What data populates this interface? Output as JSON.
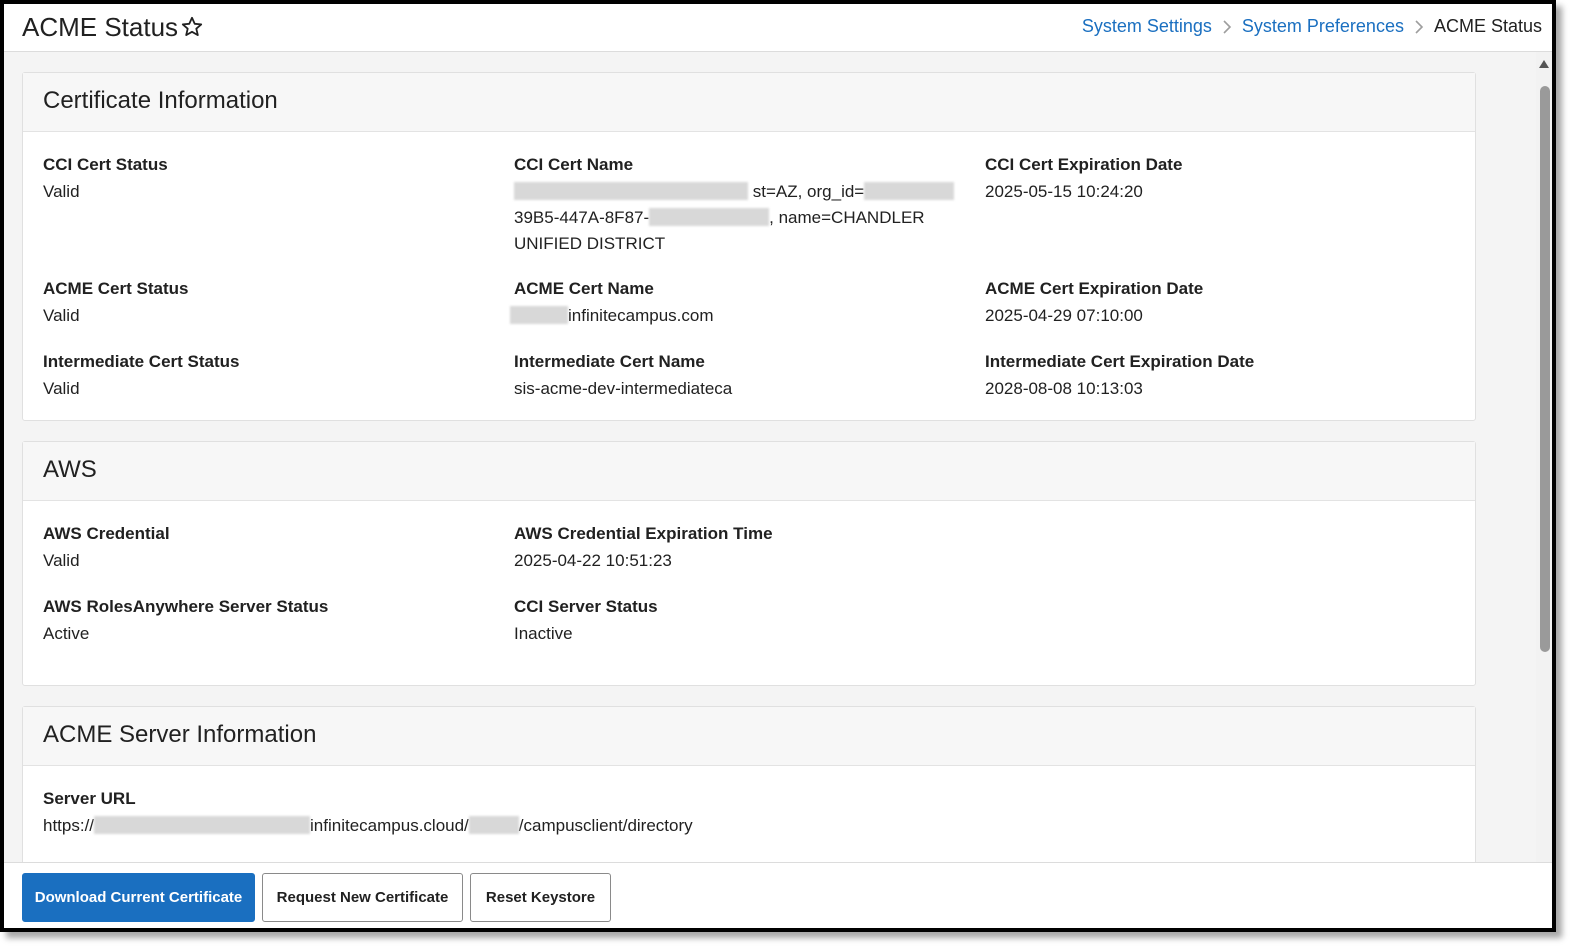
{
  "header": {
    "title": "ACME Status",
    "breadcrumb": [
      "System Settings",
      "System Preferences"
    ],
    "breadcrumb_current": "ACME Status"
  },
  "certificate": {
    "title": "Certificate Information",
    "cci_status_label": "CCI Cert Status",
    "cci_status_value": "Valid",
    "cci_name_label": "CCI Cert Name",
    "cci_name_part1": "st=AZ, org_id=",
    "cci_name_part2": "39B5-447A-8F87-",
    "cci_name_part3": ", name=CHANDLER",
    "cci_name_part4": "UNIFIED DISTRICT",
    "cci_exp_label": "CCI Cert Expiration Date",
    "cci_exp_value": "2025-05-15 10:24:20",
    "acme_status_label": "ACME Cert Status",
    "acme_status_value": "Valid",
    "acme_name_label": "ACME Cert Name",
    "acme_name_value": "infinitecampus.com",
    "acme_exp_label": "ACME Cert Expiration Date",
    "acme_exp_value": "2025-04-29 07:10:00",
    "int_status_label": "Intermediate Cert Status",
    "int_status_value": "Valid",
    "int_name_label": "Intermediate Cert Name",
    "int_name_value": "sis-acme-dev-intermediateca",
    "int_exp_label": "Intermediate Cert Expiration Date",
    "int_exp_value": "2028-08-08 10:13:03"
  },
  "aws": {
    "title": "AWS",
    "cred_label": "AWS Credential",
    "cred_value": "Valid",
    "cred_exp_label": "AWS Credential Expiration Time",
    "cred_exp_value": "2025-04-22 10:51:23",
    "roles_label": "AWS RolesAnywhere Server Status",
    "roles_value": "Active",
    "cci_server_label": "CCI Server Status",
    "cci_server_value": "Inactive"
  },
  "acme_server": {
    "title": "ACME Server Information",
    "url_label": "Server URL",
    "url_part1": "https://",
    "url_part2": "infinitecampus.cloud/",
    "url_part3": "/campusclient/directory"
  },
  "footer": {
    "download_label": "Download Current Certificate",
    "request_label": "Request New Certificate",
    "reset_label": "Reset Keystore"
  },
  "colors": {
    "link": "#1a6fc0",
    "primary_button": "#1a6fc0"
  }
}
